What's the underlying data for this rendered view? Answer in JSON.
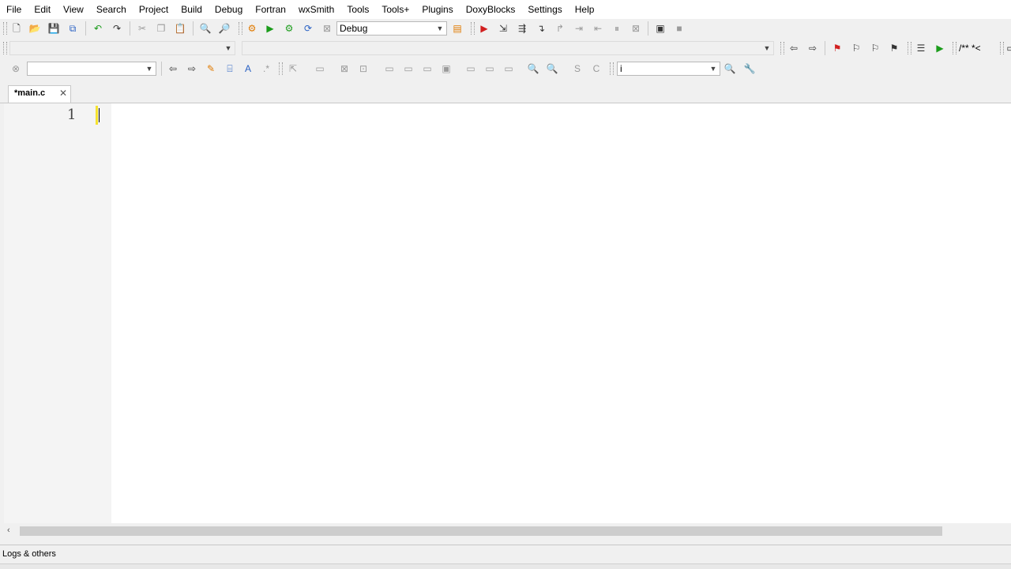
{
  "menu": [
    "File",
    "Edit",
    "View",
    "Search",
    "Project",
    "Build",
    "Debug",
    "Fortran",
    "wxSmith",
    "Tools",
    "Tools+",
    "Plugins",
    "DoxyBlocks",
    "Settings",
    "Help"
  ],
  "build_target": "Debug",
  "code_completion": {
    "scope_value": "",
    "symbol_value": "i"
  },
  "doxyblocks_label": "/** *<",
  "editor": {
    "tab_label": "*main.c",
    "line_number": "1"
  },
  "logs_panel": {
    "title": "Logs & others"
  },
  "colors": {
    "change_bar": "#f5e22e",
    "run_green": "#1b9c1b",
    "debug_red": "#d11f1f"
  }
}
